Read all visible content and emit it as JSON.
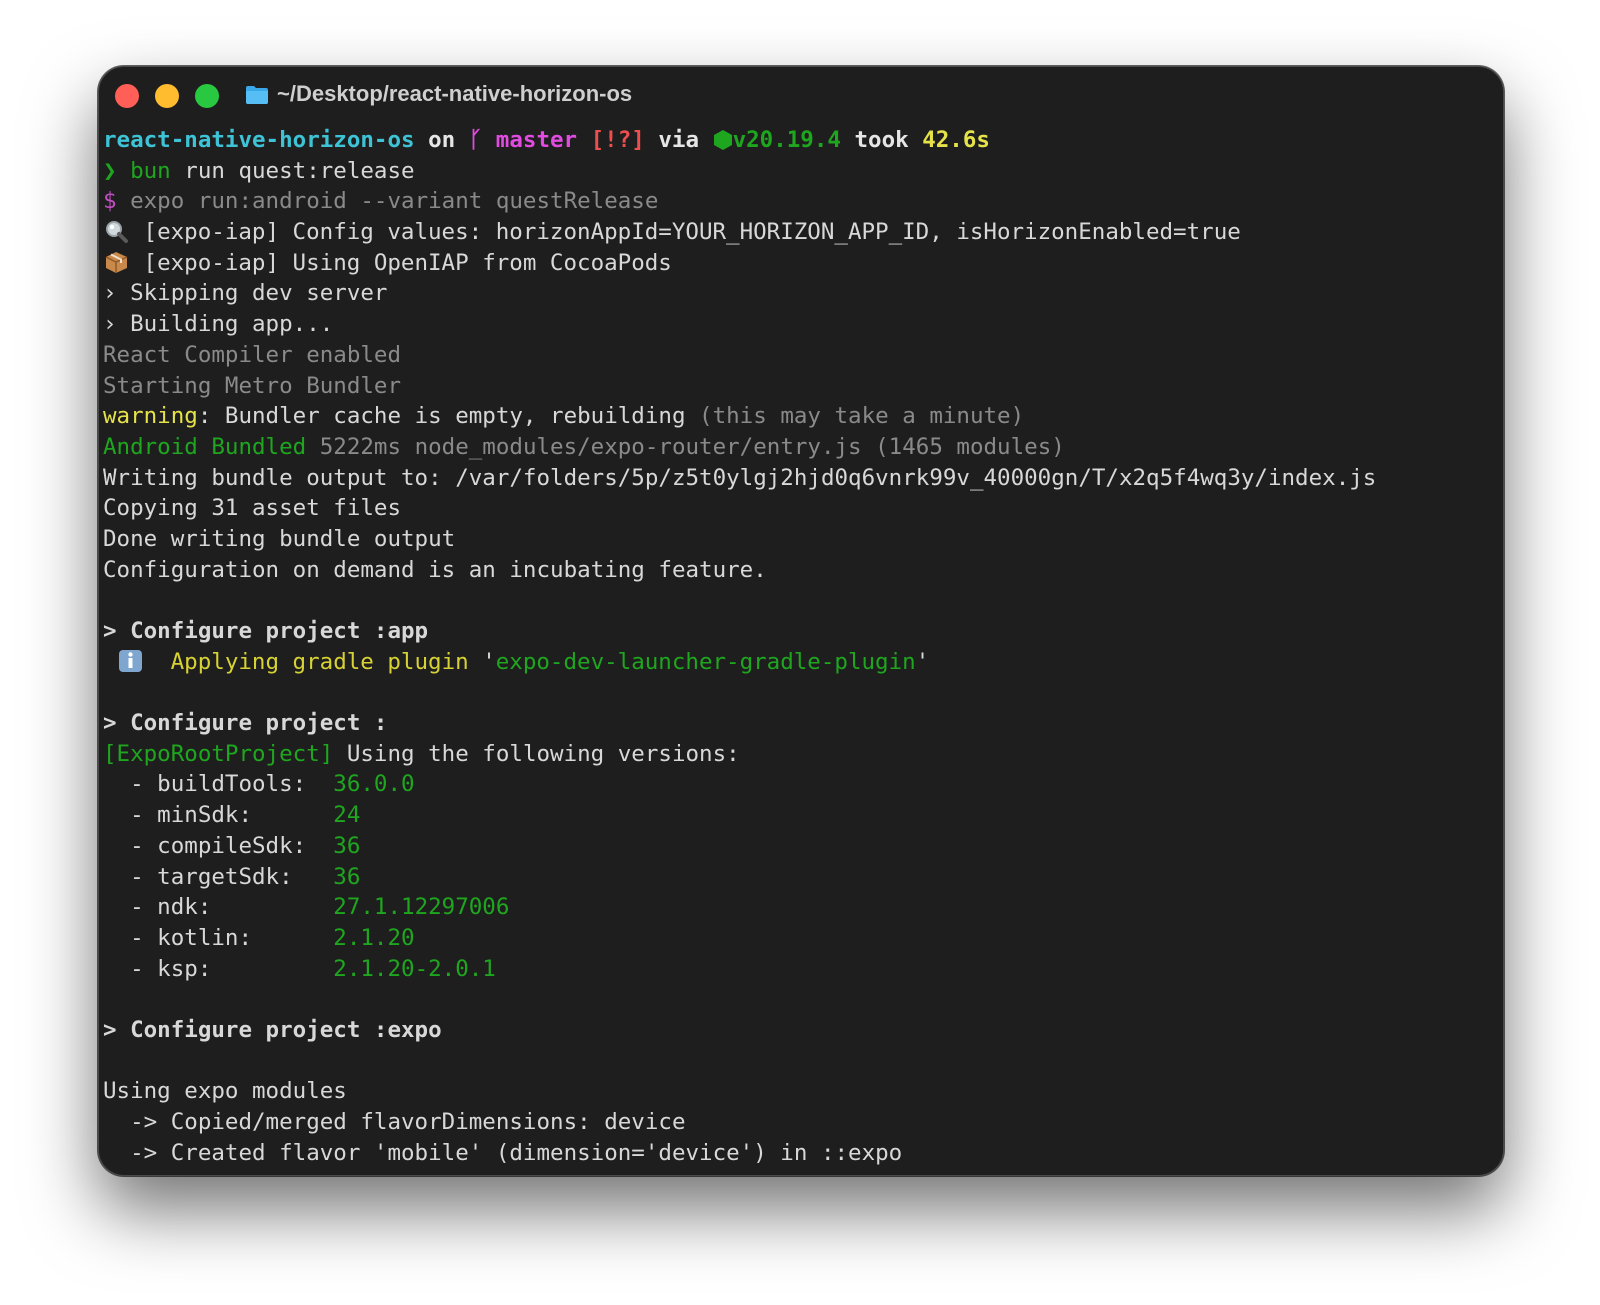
{
  "window": {
    "title": "~/Desktop/react-native-horizon-os"
  },
  "prompt": {
    "dir": "react-native-horizon-os",
    "on": " on ",
    "branch_icon": "ᚴ",
    "branch": " master ",
    "status": "[!?]",
    "via": " via ",
    "node_version": "v20.19.4",
    "took": " took ",
    "duration": "42.6s"
  },
  "lines": {
    "cmd_arrow": "❯ ",
    "cmd_tool": "bun",
    "cmd_rest": " run quest:release",
    "echo_dollar": "$ ",
    "echo_cmd": "expo run:android --variant questRelease",
    "iap_config": " [expo-iap] Config values: horizonAppId=YOUR_HORIZON_APP_ID, isHorizonEnabled=true",
    "iap_openiap": " [expo-iap] Using OpenIAP from CocoaPods",
    "skipping": "› Skipping dev server",
    "building": "› Building app...",
    "compiler": "React Compiler enabled",
    "metro": "Starting Metro Bundler",
    "warning_label": "warning",
    "warning_text": ": Bundler cache is empty, rebuilding ",
    "warning_dim": "(this may take a minute)",
    "bundled_label": "Android Bundled",
    "bundled_rest": " 5222ms node_modules/expo-router/entry.js (1465 modules)",
    "writing": "Writing bundle output to: /var/folders/5p/z5t0ylgj2hjd0q6vnrk99v_40000gn/T/x2q5f4wq3y/index.js",
    "copying": "Copying 31 asset files",
    "done": "Done writing bundle output",
    "config_demand": "Configuration on demand is an incubating feature.",
    "configure_app": "> Configure project :app",
    "applying": "Applying gradle plugin",
    "quote_open": " '",
    "plugin_name": "expo-dev-launcher-gradle-plugin",
    "quote_close": "'",
    "configure_root": "> Configure project :",
    "root_tag": "[ExpoRootProject]",
    "root_text": " Using the following versions:",
    "configure_expo": "> Configure project :expo",
    "using_modules": "Using expo modules",
    "copied": "  -> Copied/merged flavorDimensions: device",
    "created": "  -> Created flavor 'mobile' (dimension='device') in ::expo"
  },
  "versions": [
    {
      "label": "  - buildTools:  ",
      "value": "36.0.0"
    },
    {
      "label": "  - minSdk:      ",
      "value": "24"
    },
    {
      "label": "  - compileSdk:  ",
      "value": "36"
    },
    {
      "label": "  - targetSdk:   ",
      "value": "36"
    },
    {
      "label": "  - ndk:         ",
      "value": "27.1.12297006"
    },
    {
      "label": "  - kotlin:      ",
      "value": "2.1.20"
    },
    {
      "label": "  - ksp:         ",
      "value": "2.1.20-2.0.1"
    }
  ],
  "icons": {
    "close": "close-traffic-light",
    "minimize": "minimize-traffic-light",
    "zoom": "zoom-traffic-light",
    "folder": "folder-icon",
    "node": "node-hexagon-icon",
    "search": "magnifying-glass-icon",
    "package": "package-box-icon",
    "info": "info-icon"
  },
  "colors": {
    "background": "#1e1e1e",
    "cyan": "#3ec3d6",
    "magenta": "#e14be0",
    "red": "#ee4e4e",
    "green": "#1fa61f",
    "yellow": "#e6e24a"
  }
}
